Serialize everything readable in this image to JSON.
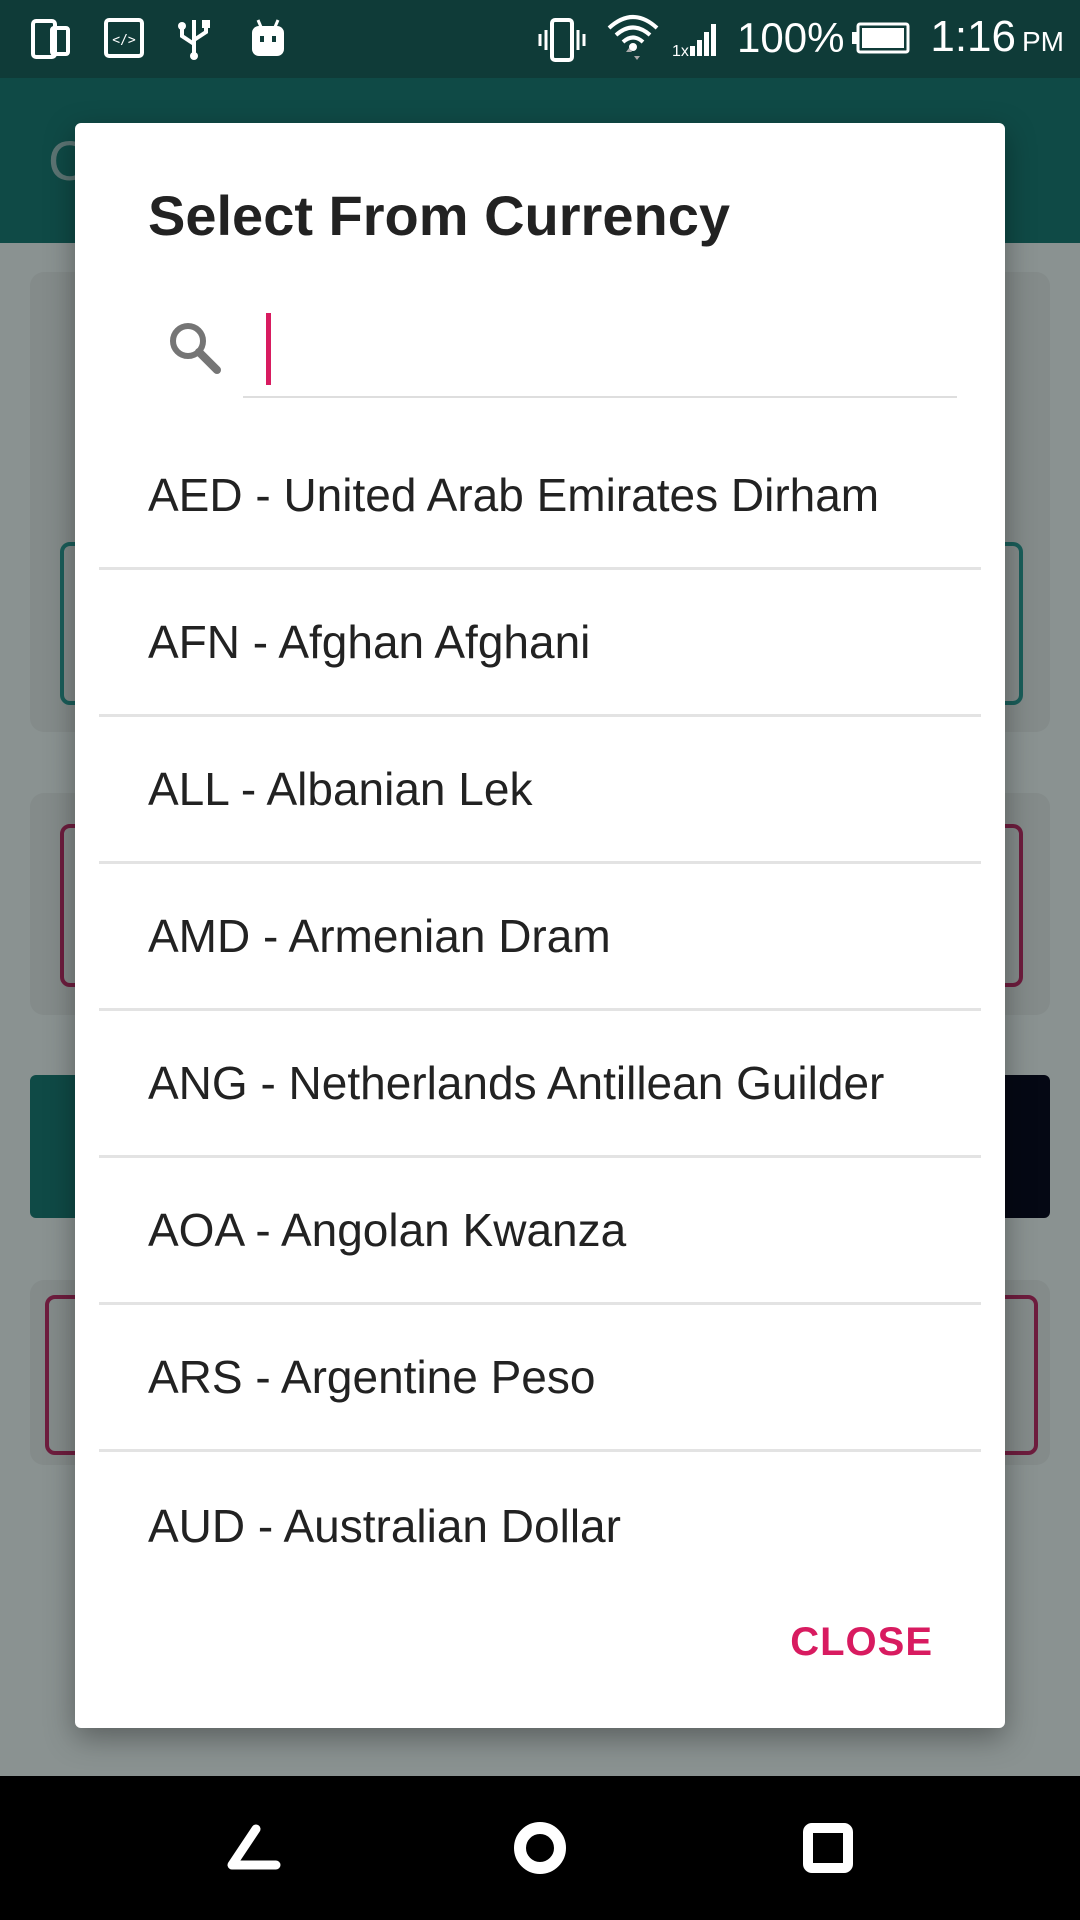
{
  "status_bar": {
    "battery_percent": "100%",
    "time": "1:16",
    "ampm": "PM",
    "icons": [
      "sim-card-icon",
      "developer-code-icon",
      "usb-icon",
      "android-icon",
      "vibrate-icon",
      "wifi-icon",
      "signal-icon",
      "battery-icon"
    ]
  },
  "background_app": {
    "title_fragment": "C"
  },
  "dialog": {
    "title": "Select From Currency",
    "search": {
      "value": "",
      "placeholder": "",
      "icon": "search-icon"
    },
    "currencies": [
      "AED - United Arab Emirates Dirham",
      "AFN - Afghan Afghani",
      "ALL - Albanian Lek",
      "AMD - Armenian Dram",
      "ANG - Netherlands Antillean Guilder",
      "AOA - Angolan Kwanza",
      "ARS - Argentine Peso",
      "AUD - Australian Dollar"
    ],
    "close_label": "CLOSE"
  },
  "colors": {
    "accent": "#d81b60",
    "primary_dark": "#0f3b38",
    "primary": "#0f4a46"
  },
  "nav_bar": {
    "buttons": [
      "back-icon",
      "home-icon",
      "recents-icon"
    ]
  }
}
